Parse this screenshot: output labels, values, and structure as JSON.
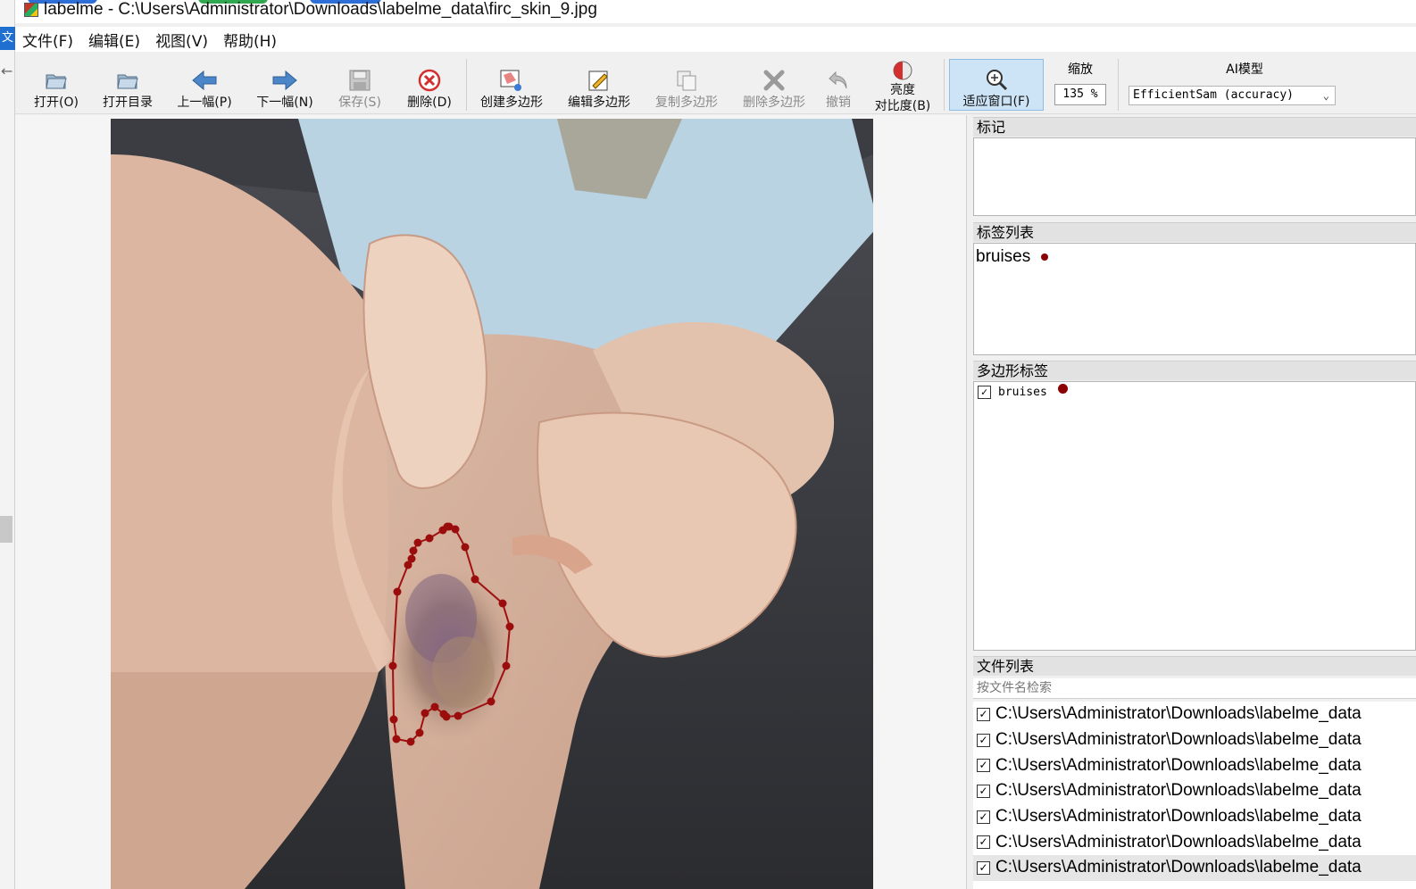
{
  "window": {
    "title": "labelme - C:\\Users\\Administrator\\Downloads\\labelme_data\\firc_skin_9.jpg"
  },
  "side_strip": {
    "tab_text": "文"
  },
  "menu": [
    "文件(F)",
    "编辑(E)",
    "视图(V)",
    "帮助(H)"
  ],
  "toolbar": {
    "open": "打开(O)",
    "open_dir": "打开目录",
    "prev": "上一幅(P)",
    "next": "下一幅(N)",
    "save": "保存(S)",
    "delete": "删除(D)",
    "create_poly": "创建多边形",
    "edit_poly": "编辑多边形",
    "copy_poly": "复制多边形",
    "delete_poly": "删除多边形",
    "undo": "撤销",
    "brightness_line1": "亮度",
    "brightness_line2": "对比度(B)",
    "fit_window": "适应窗口(F)",
    "zoom_label": "缩放",
    "zoom_value": "135 %",
    "ai_label": "AI模型",
    "ai_model": "EfficientSam (accuracy)"
  },
  "panels": {
    "flags_title": "标记",
    "label_list_title": "标签列表",
    "polygon_labels_title": "多边形标签",
    "file_list_title": "文件列表"
  },
  "label_list": [
    {
      "name": "bruises",
      "color": "#8b0000"
    }
  ],
  "polygon_labels": [
    {
      "name": "bruises",
      "checked": true,
      "color": "#8b0000"
    }
  ],
  "file_search": {
    "placeholder": "按文件名检索"
  },
  "files": [
    {
      "path": "C:\\Users\\Administrator\\Downloads\\labelme_data",
      "checked": true
    },
    {
      "path": "C:\\Users\\Administrator\\Downloads\\labelme_data",
      "checked": true
    },
    {
      "path": "C:\\Users\\Administrator\\Downloads\\labelme_data",
      "checked": true
    },
    {
      "path": "C:\\Users\\Administrator\\Downloads\\labelme_data",
      "checked": true
    },
    {
      "path": "C:\\Users\\Administrator\\Downloads\\labelme_data",
      "checked": true
    },
    {
      "path": "C:\\Users\\Administrator\\Downloads\\labelme_data",
      "checked": true
    },
    {
      "path": "C:\\Users\\Administrator\\Downloads\\labelme_data",
      "checked": true,
      "selected": true
    }
  ],
  "colors": {
    "accent_active": "#cde4f7",
    "polygon": "#8b0000"
  }
}
